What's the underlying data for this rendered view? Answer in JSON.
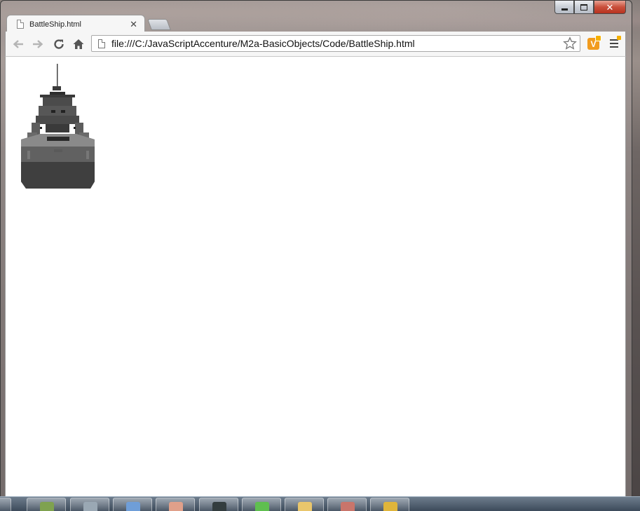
{
  "window": {
    "minimize_label": "minimize",
    "maximize_label": "maximize",
    "close_label": "✕"
  },
  "tabs": [
    {
      "title": "BattleShip.html",
      "close": "✕"
    }
  ],
  "toolbar": {
    "url": "file:///C:/JavaScriptAccenture/M2a-BasicObjects/Code/BattleShip.html",
    "extension_letter": "V"
  },
  "page": {
    "image_alt": "battleship"
  },
  "taskbar": {
    "items": [
      {
        "name": "task-1",
        "color": "#c94a3a"
      },
      {
        "name": "task-2",
        "color": "#7fa24f"
      },
      {
        "name": "task-3",
        "color": "#9aa8b4"
      },
      {
        "name": "task-4",
        "color": "#6f9ed8"
      },
      {
        "name": "task-5",
        "color": "#e0a08a"
      },
      {
        "name": "task-6",
        "color": "#333d3f"
      },
      {
        "name": "task-7",
        "color": "#5fbf4f"
      },
      {
        "name": "task-8",
        "color": "#e9c66c"
      },
      {
        "name": "task-9",
        "color": "#c9756b"
      },
      {
        "name": "task-10",
        "color": "#e0b53a"
      }
    ]
  }
}
